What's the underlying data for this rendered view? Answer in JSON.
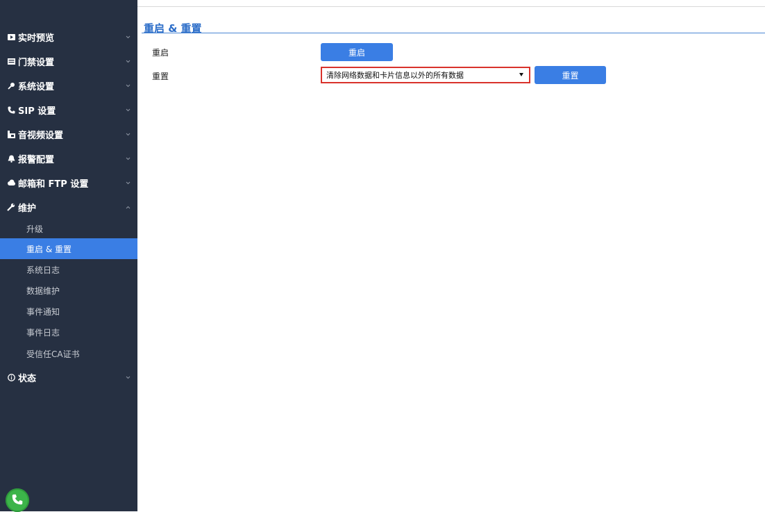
{
  "sidebar": {
    "groups": [
      {
        "label": "实时预览",
        "icon": "monitor-icon",
        "expanded": false
      },
      {
        "label": "门禁设置",
        "icon": "door-icon",
        "expanded": false
      },
      {
        "label": "系统设置",
        "icon": "key-icon",
        "expanded": false
      },
      {
        "label": "SIP 设置",
        "icon": "phone-icon",
        "expanded": false
      },
      {
        "label": "音视频设置",
        "icon": "media-icon",
        "expanded": false
      },
      {
        "label": "报警配置",
        "icon": "bell-icon",
        "expanded": false
      },
      {
        "label": "邮箱和 FTP 设置",
        "icon": "cloud-icon",
        "expanded": false
      },
      {
        "label": "维护",
        "icon": "wrench-icon",
        "expanded": true
      },
      {
        "label": "状态",
        "icon": "info-icon",
        "expanded": false
      }
    ],
    "maintenance_items": [
      {
        "label": "升级",
        "active": false
      },
      {
        "label": "重启 & 重置",
        "active": true
      },
      {
        "label": "系统日志",
        "active": false
      },
      {
        "label": "数据维护",
        "active": false
      },
      {
        "label": "事件通知",
        "active": false
      },
      {
        "label": "事件日志",
        "active": false
      },
      {
        "label": "受信任CA证书",
        "active": false
      }
    ],
    "fab_icon": "phone-call-icon"
  },
  "main": {
    "title": "重启 & 重置",
    "reboot": {
      "label": "重启",
      "button_label": "重启"
    },
    "reset": {
      "label": "重置",
      "selected_option": "清除网络数据和卡片信息以外的所有数据",
      "button_label": "重置"
    }
  },
  "colors": {
    "sidebar_bg": "#263042",
    "accent": "#3a7ee4",
    "title": "#2a6cc8",
    "select_highlight": "#d9322b",
    "fab": "#3cb44a"
  }
}
